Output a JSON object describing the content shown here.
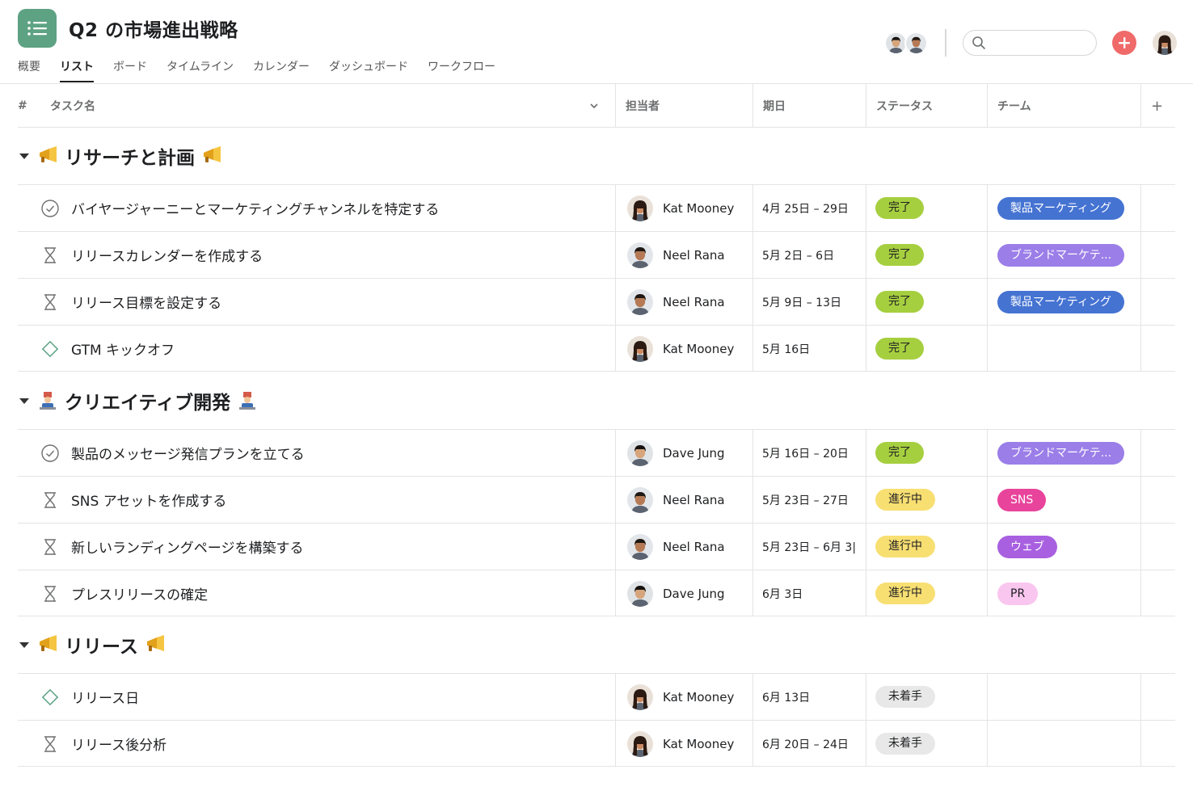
{
  "project": {
    "title": "Q2 の市場進出戦略",
    "icon": "list-icon",
    "color": "#5da283"
  },
  "tabs": [
    {
      "label": "概要",
      "active": false
    },
    {
      "label": "リスト",
      "active": true
    },
    {
      "label": "ボード",
      "active": false
    },
    {
      "label": "タイムライン",
      "active": false
    },
    {
      "label": "カレンダー",
      "active": false
    },
    {
      "label": "ダッシュボード",
      "active": false
    },
    {
      "label": "ワークフロー",
      "active": false
    }
  ],
  "search": {
    "value": "",
    "placeholder": ""
  },
  "columns": {
    "num": "#",
    "task": "タスク名",
    "assignee": "担当者",
    "due": "期日",
    "status": "ステータス",
    "team": "チーム",
    "add": "+"
  },
  "colors": {
    "done": "#a6cf3f",
    "in_progress": "#f8df72",
    "not_started": "#e8e8e8",
    "product_marketing": "#4573d2",
    "brand_marketing": "#9b7ee8",
    "sns": "#e8449b",
    "web": "#a860e0",
    "pr": "#f9c6ef",
    "add_button": "#f06a6a"
  },
  "sections": [
    {
      "name": "リサーチと計画",
      "emoji": "megaphone-icon",
      "tasks": [
        {
          "icon": "check-circle-icon",
          "name": "バイヤージャーニーとマーケティングチャンネルを特定する",
          "assignee": "Kat Mooney",
          "avatar": "kat",
          "due": "4月 25日 – 29日",
          "status": "完了",
          "status_type": "done",
          "team": "製品マーケティング",
          "team_type": "product_marketing"
        },
        {
          "icon": "hourglass-icon",
          "name": "リリースカレンダーを作成する",
          "assignee": "Neel Rana",
          "avatar": "neel",
          "due": "5月 2日 – 6日",
          "status": "完了",
          "status_type": "done",
          "team": "ブランドマーケテ...",
          "team_type": "brand_marketing"
        },
        {
          "icon": "hourglass-icon",
          "name": "リリース目標を設定する",
          "assignee": "Neel Rana",
          "avatar": "neel",
          "due": "5月 9日 – 13日",
          "status": "完了",
          "status_type": "done",
          "team": "製品マーケティング",
          "team_type": "product_marketing"
        },
        {
          "icon": "diamond-icon",
          "name": "GTM キックオフ",
          "assignee": "Kat Mooney",
          "avatar": "kat",
          "due": "5月 16日",
          "status": "完了",
          "status_type": "done",
          "team": "",
          "team_type": ""
        }
      ]
    },
    {
      "name": "クリエイティブ開発",
      "emoji": "artist-icon",
      "tasks": [
        {
          "icon": "check-circle-icon",
          "name": "製品のメッセージ発信プランを立てる",
          "assignee": "Dave Jung",
          "avatar": "dave",
          "due": "5月 16日 – 20日",
          "status": "完了",
          "status_type": "done",
          "team": "ブランドマーケテ...",
          "team_type": "brand_marketing"
        },
        {
          "icon": "hourglass-icon",
          "name": "SNS アセットを作成する",
          "assignee": "Neel Rana",
          "avatar": "neel",
          "due": "5月 23日 – 27日",
          "status": "進行中",
          "status_type": "in_progress",
          "team": "SNS",
          "team_type": "sns"
        },
        {
          "icon": "hourglass-icon",
          "name": "新しいランディングページを構築する",
          "assignee": "Neel Rana",
          "avatar": "neel",
          "due": "5月 23日 – 6月 3|",
          "status": "進行中",
          "status_type": "in_progress",
          "team": "ウェブ",
          "team_type": "web"
        },
        {
          "icon": "hourglass-icon",
          "name": "プレスリリースの確定",
          "assignee": "Dave Jung",
          "avatar": "dave",
          "due": "6月 3日",
          "status": "進行中",
          "status_type": "in_progress",
          "team": "PR",
          "team_type": "pr"
        }
      ]
    },
    {
      "name": "リリース",
      "emoji": "megaphone-icon",
      "tasks": [
        {
          "icon": "diamond-icon",
          "name": "リリース日",
          "assignee": "Kat Mooney",
          "avatar": "kat",
          "due": "6月 13日",
          "status": "未着手",
          "status_type": "not_started",
          "team": "",
          "team_type": ""
        },
        {
          "icon": "hourglass-icon",
          "name": "リリース後分析",
          "assignee": "Kat Mooney",
          "avatar": "kat",
          "due": "6月 20日 – 24日",
          "status": "未着手",
          "status_type": "not_started",
          "team": "",
          "team_type": ""
        }
      ]
    }
  ]
}
